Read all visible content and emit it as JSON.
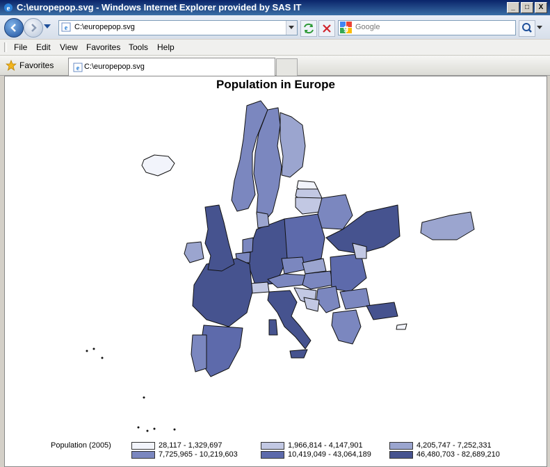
{
  "window": {
    "title": "C:\\europepop.svg - Windows Internet Explorer provided by SAS IT",
    "buttons": [
      "_",
      "□",
      "X"
    ]
  },
  "address": {
    "url": "C:\\europepop.svg"
  },
  "search": {
    "placeholder": "Google"
  },
  "menu": {
    "items": [
      "File",
      "Edit",
      "View",
      "Favorites",
      "Tools",
      "Help"
    ]
  },
  "favorites": {
    "label": "Favorites",
    "tab_label": "C:\\europepop.svg"
  },
  "map": {
    "title": "Population in Europe"
  },
  "legend": {
    "title": "Population (2005)",
    "classes": [
      {
        "label": "28,117 - 1,329,697",
        "color": "#f2f4fb"
      },
      {
        "label": "1,966,814 - 4,147,901",
        "color": "#c2c8e3"
      },
      {
        "label": "4,205,747 - 7,252,331",
        "color": "#9ba5cf"
      },
      {
        "label": "7,725,965 - 10,219,603",
        "color": "#7b87bf"
      },
      {
        "label": "10,419,049 - 43,064,189",
        "color": "#5d6aab"
      },
      {
        "label": "46,480,703 - 82,689,210",
        "color": "#46538f"
      }
    ]
  },
  "icons": {
    "back": "back-arrow-icon",
    "forward": "forward-arrow-icon",
    "refresh": "refresh-icon",
    "stop": "stop-icon",
    "search": "search-icon",
    "favorites": "favorites-star-icon"
  }
}
